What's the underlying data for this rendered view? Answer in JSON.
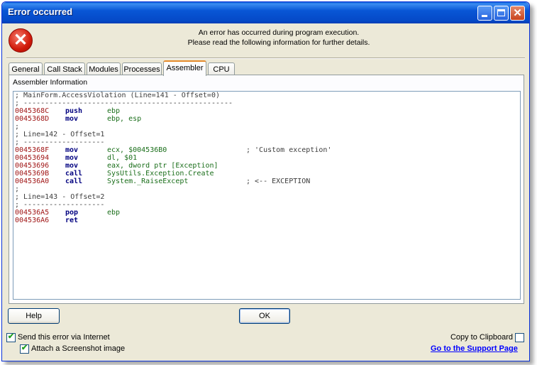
{
  "window": {
    "title": "Error occurred",
    "controls": {
      "minimize": "minimize-icon",
      "maximize": "maximize-icon",
      "close": "✕"
    }
  },
  "icon": {
    "name": "error-icon",
    "glyph": "✕",
    "color": "#d11a0a"
  },
  "message": {
    "line1": "An error has occurred during program execution.",
    "line2": "Please read the following information for further details."
  },
  "tabs": [
    {
      "label": "General"
    },
    {
      "label": "Call Stack"
    },
    {
      "label": "Modules"
    },
    {
      "label": "Processes"
    },
    {
      "label": "Assembler",
      "active": true
    },
    {
      "label": "CPU"
    }
  ],
  "panel": {
    "label": "Assembler Information",
    "lines": [
      {
        "comment": "; MainForm.AccessViolation (Line=141 - Offset=0)"
      },
      {
        "comment": "; -------------------------------------------------"
      },
      {
        "addr": "0045368C",
        "op": "push",
        "arg": "ebp"
      },
      {
        "addr": "0045368D",
        "op": "mov",
        "arg": "ebp, esp"
      },
      {
        "comment": ";"
      },
      {
        "comment": "; Line=142 - Offset=1"
      },
      {
        "comment": "; -------------------"
      },
      {
        "addr": "0045368F",
        "op": "mov",
        "arg": "ecx, $004536B0",
        "note": "; 'Custom exception'"
      },
      {
        "addr": "00453694",
        "op": "mov",
        "arg": "dl, $01"
      },
      {
        "addr": "00453696",
        "op": "mov",
        "arg": "eax, dword ptr [Exception]"
      },
      {
        "addr": "0045369B",
        "op": "call",
        "arg": "SysUtils.Exception.Create"
      },
      {
        "addr": "004536A0",
        "op": "call",
        "arg": "System._RaiseExcept",
        "note": "; <-- EXCEPTION"
      },
      {
        "comment": ";"
      },
      {
        "comment": "; Line=143 - Offset=2"
      },
      {
        "comment": "; -------------------"
      },
      {
        "addr": "004536A5",
        "op": "pop",
        "arg": "ebp"
      },
      {
        "addr": "004536A6",
        "op": "ret"
      }
    ]
  },
  "buttons": {
    "help": "Help",
    "ok": "OK"
  },
  "options": {
    "send_error": {
      "label": "Send this error via Internet",
      "checked": true
    },
    "attach_screenshot": {
      "label": "Attach a Screenshot image",
      "checked": true
    },
    "copy_clipboard": {
      "label": "Copy to Clipboard",
      "checked": false
    }
  },
  "support_link": "Go to the Support Page",
  "colors": {
    "titlebar": "#0856d6",
    "address": "#a01515",
    "opcode": "#000080",
    "operand": "#1a6e1a",
    "link": "#0000ff"
  }
}
